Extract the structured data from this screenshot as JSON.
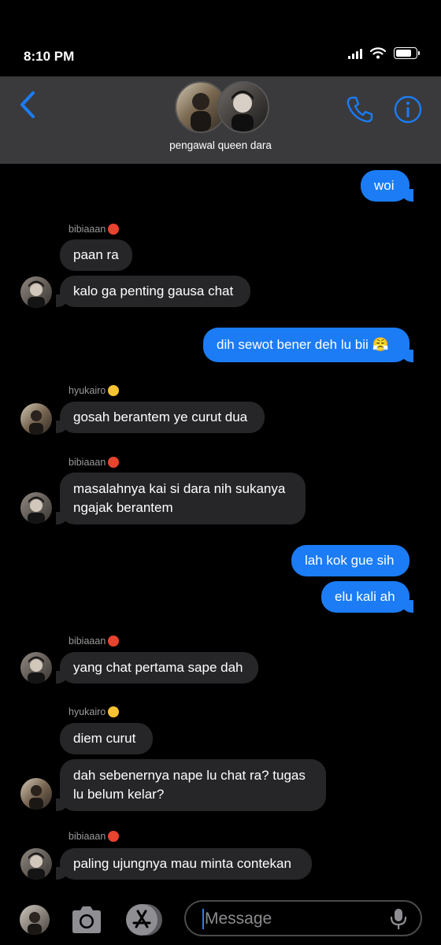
{
  "status": {
    "time": "8:10 PM",
    "battery_fraction": 0.88
  },
  "header": {
    "group_name": "pengawal queen dara",
    "back_label": "back",
    "call_label": "call",
    "info_label": "info"
  },
  "senders": {
    "bibi": "bibiaaan",
    "hyuka": "hyukairo"
  },
  "messages": {
    "m1": "woi",
    "m2": "paan ra",
    "m3": "kalo ga penting gausa chat",
    "m4": "dih sewot bener deh lu bii 😤",
    "m5": "gosah berantem ye curut dua",
    "m6a": "masalahnya kai si dara nih sukanya",
    "m6b": "ngajak berantem",
    "m7": "lah kok gue sih",
    "m8": "elu kali ah",
    "m9": "yang chat pertama sape dah",
    "m10": "diem curut",
    "m11a": "dah sebenernya nape lu chat ra? tugas",
    "m11b": "lu belum kelar?",
    "m12": "paling ujungnya mau minta contekan"
  },
  "input": {
    "placeholder": "Message"
  },
  "colors": {
    "outgoing": "#1b7cf5",
    "incoming": "#262629",
    "header": "#3a3a3c",
    "accent": "#2b7cf7"
  },
  "icons": [
    "back-chevron-icon",
    "phone-icon",
    "info-icon",
    "camera-icon",
    "app-store-icon",
    "microphone-icon",
    "angry-face-icon",
    "dizzy-face-icon"
  ]
}
